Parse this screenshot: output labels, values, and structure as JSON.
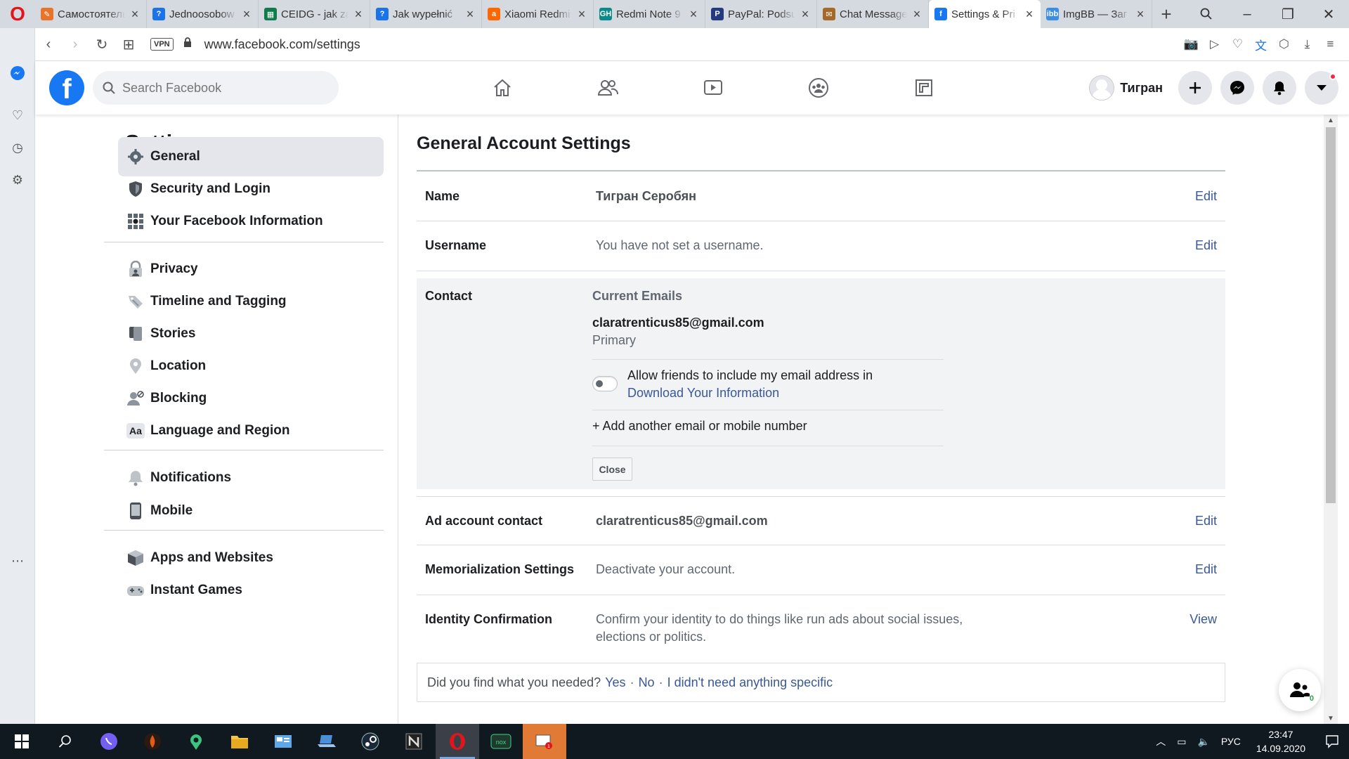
{
  "browser": {
    "tabs": [
      {
        "title": "Самостоятель",
        "fav_color": "#e8732a",
        "fav_glyph": "✎",
        "active": false
      },
      {
        "title": "Jednoosobow",
        "fav_color": "#1a73e8",
        "fav_glyph": "?",
        "active": false
      },
      {
        "title": "CEIDG - jak za",
        "fav_color": "#0f7a4a",
        "fav_glyph": "▦",
        "active": false
      },
      {
        "title": "Jak wypełnić",
        "fav_color": "#1a73e8",
        "fav_glyph": "?",
        "active": false
      },
      {
        "title": "Xiaomi Redmi",
        "fav_color": "#ff6600",
        "fav_glyph": "a",
        "active": false
      },
      {
        "title": "Redmi Note 9",
        "fav_color": "#0a8a8a",
        "fav_glyph": "GH",
        "active": false
      },
      {
        "title": "PayPal: Podsu",
        "fav_color": "#253b80",
        "fav_glyph": "P",
        "active": false
      },
      {
        "title": "Chat Message",
        "fav_color": "#a56a2a",
        "fav_glyph": "✉",
        "active": false
      },
      {
        "title": "Settings & Pri",
        "fav_color": "#1877f2",
        "fav_glyph": "f",
        "active": true
      },
      {
        "title": "ImgBB — Заг",
        "fav_color": "#3b8ee8",
        "fav_glyph": "ibb",
        "active": false
      }
    ],
    "vpn_label": "VPN",
    "url": "www.facebook.com/settings"
  },
  "fb": {
    "search_placeholder": "Search Facebook",
    "profile_name": "Тигран",
    "accent": "#1877f2"
  },
  "settings_nav": {
    "title": "Settings",
    "items": [
      {
        "label": "General",
        "icon": "gear-icon",
        "active": true
      },
      {
        "label": "Security and Login",
        "icon": "shield-icon",
        "active": false
      },
      {
        "label": "Your Facebook Information",
        "icon": "grid-icon",
        "active": false
      },
      {
        "label": "Privacy",
        "icon": "lock-person-icon",
        "active": false
      },
      {
        "label": "Timeline and Tagging",
        "icon": "tag-icon",
        "active": false
      },
      {
        "label": "Stories",
        "icon": "book-icon",
        "active": false
      },
      {
        "label": "Location",
        "icon": "location-pin-icon",
        "active": false
      },
      {
        "label": "Blocking",
        "icon": "block-user-icon",
        "active": false
      },
      {
        "label": "Language and Region",
        "icon": "language-icon",
        "active": false
      },
      {
        "label": "Notifications",
        "icon": "bell-icon",
        "active": false
      },
      {
        "label": "Mobile",
        "icon": "mobile-icon",
        "active": false
      },
      {
        "label": "Apps and Websites",
        "icon": "cube-icon",
        "active": false
      },
      {
        "label": "Instant Games",
        "icon": "gamepad-icon",
        "active": false
      }
    ]
  },
  "main": {
    "title": "General Account Settings",
    "rows": [
      {
        "label": "Name",
        "value": "Тигран Серобян",
        "action": "Edit"
      },
      {
        "label": "Username",
        "value": "You have not set a username.",
        "action": "Edit"
      },
      {
        "label": "Ad account contact",
        "value": "claratrenticus85@gmail.com",
        "action": "Edit"
      },
      {
        "label": "Memorialization Settings",
        "value": "Deactivate your account.",
        "action": "Edit"
      },
      {
        "label": "Identity Confirmation",
        "value": "Confirm your identity to do things like run ads about social issues, elections or politics.",
        "action": "View"
      }
    ],
    "contact": {
      "label": "Contact",
      "current_emails": "Current Emails",
      "email": "claratrenticus85@gmail.com",
      "primary": "Primary",
      "allow_text": "Allow friends to include my email address in",
      "download_link": "Download Your Information",
      "toggle_on": false,
      "add_another": "+ Add another email or mobile number",
      "close": "Close"
    },
    "feedback": {
      "question": "Did you find what you needed?",
      "yes": "Yes",
      "no": "No",
      "none": "I didn't need anything specific",
      "sep": "·"
    },
    "fab_badge": "0"
  },
  "taskbar": {
    "lang": "РУС",
    "time": "23:47",
    "date": "14.09.2020"
  }
}
